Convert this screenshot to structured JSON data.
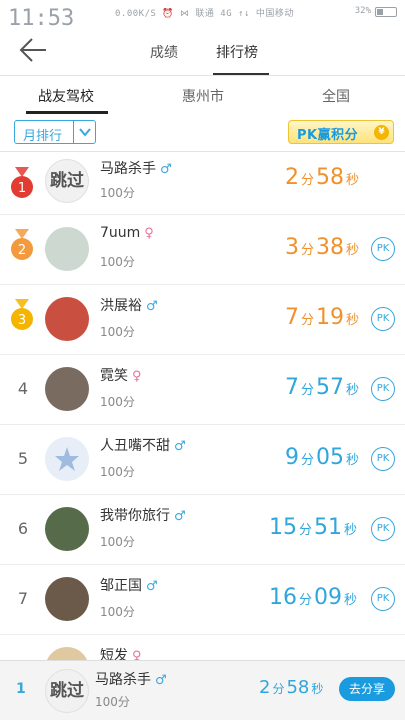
{
  "status_bar": {
    "time": "11:53",
    "info": "0.00K/S  ⏰  ⋈  联通 4G  ↑↓  中国移动",
    "battery": "32%",
    "battery_level": 0.32
  },
  "topbar": {
    "tab_scores": "成绩",
    "tab_ranking": "排行榜"
  },
  "subtabs": {
    "school": "战友驾校",
    "city": "惠州市",
    "national": "全国"
  },
  "filter": {
    "period": "月排行",
    "pk_banner": "PK赢积分",
    "pk_coin": "¥"
  },
  "colors": {
    "accent": "#38a7dd",
    "gold": "#f0912c",
    "gold_medal": "#e23b32",
    "silver_medal": "#f39a3e",
    "bronze_medal": "#f4b400"
  },
  "rows": [
    {
      "rank": "1",
      "medal": "gold",
      "avatar_text": "跳过",
      "name": "马路杀手",
      "gender": "♂",
      "gender_type": "m",
      "score": "100分",
      "min": "2",
      "min_unit": "分",
      "sec": "58",
      "sec_unit": "秒",
      "time_color": "orange",
      "pk": ""
    },
    {
      "rank": "2",
      "medal": "silver",
      "avatar_text": "",
      "name": "7uum",
      "gender": "♀",
      "gender_type": "f",
      "score": "100分",
      "min": "3",
      "min_unit": "分",
      "sec": "38",
      "sec_unit": "秒",
      "time_color": "orange",
      "pk": "PK"
    },
    {
      "rank": "3",
      "medal": "bronze",
      "avatar_text": "",
      "name": "洪展裕",
      "gender": "♂",
      "gender_type": "m",
      "score": "100分",
      "min": "7",
      "min_unit": "分",
      "sec": "19",
      "sec_unit": "秒",
      "time_color": "orange",
      "pk": "PK"
    },
    {
      "rank": "4",
      "medal": "",
      "avatar_text": "",
      "name": "霓笑",
      "gender": "♀",
      "gender_type": "f",
      "score": "100分",
      "min": "7",
      "min_unit": "分",
      "sec": "57",
      "sec_unit": "秒",
      "time_color": "blue",
      "pk": "PK"
    },
    {
      "rank": "5",
      "medal": "",
      "avatar_text": "",
      "name": "人丑嘴不甜",
      "gender": "♂",
      "gender_type": "m",
      "score": "100分",
      "min": "9",
      "min_unit": "分",
      "sec": "05",
      "sec_unit": "秒",
      "time_color": "blue",
      "pk": "PK"
    },
    {
      "rank": "6",
      "medal": "",
      "avatar_text": "",
      "name": "我带你旅行",
      "gender": "♂",
      "gender_type": "m",
      "score": "100分",
      "min": "15",
      "min_unit": "分",
      "sec": "51",
      "sec_unit": "秒",
      "time_color": "blue",
      "pk": "PK"
    },
    {
      "rank": "7",
      "medal": "",
      "avatar_text": "",
      "name": "邹正国",
      "gender": "♂",
      "gender_type": "m",
      "score": "100分",
      "min": "16",
      "min_unit": "分",
      "sec": "09",
      "sec_unit": "秒",
      "time_color": "blue",
      "pk": "PK"
    },
    {
      "rank": "",
      "medal": "",
      "avatar_text": "",
      "name": "短发",
      "gender": "♀",
      "gender_type": "f",
      "score": "",
      "min": "",
      "min_unit": "",
      "sec": "",
      "sec_unit": "",
      "time_color": "blue",
      "pk": ""
    }
  ],
  "bottom": {
    "rank": "1",
    "avatar_text": "跳过",
    "name": "马路杀手",
    "gender": "♂",
    "score": "100分",
    "min": "2",
    "min_unit": "分",
    "sec": "58",
    "sec_unit": "秒",
    "share": "去分享"
  }
}
